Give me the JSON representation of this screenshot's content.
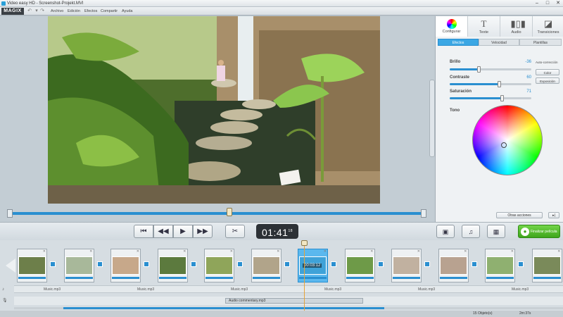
{
  "window": {
    "title": "Video easy HD - Screenshot-Projekt.MVI",
    "minimize": "–",
    "maximize": "□",
    "close": "✕"
  },
  "menu": {
    "logo": "MAGIX",
    "items": [
      "Archivo",
      "Edición",
      "Efectos",
      "Compartir",
      "Ayuda"
    ]
  },
  "panel": {
    "tabs": [
      {
        "label": "Configurar",
        "icon": "color-wheel-icon",
        "active": true
      },
      {
        "label": "Texte",
        "icon": "text-icon",
        "active": false
      },
      {
        "label": "Audio",
        "icon": "audio-icon",
        "active": false
      },
      {
        "label": "Transiciones",
        "icon": "transition-icon",
        "active": false
      }
    ],
    "subtabs": [
      {
        "label": "Efectos",
        "active": true
      },
      {
        "label": "Velocidad",
        "active": false
      },
      {
        "label": "Plantillas",
        "active": false
      }
    ],
    "sliders": [
      {
        "label": "Brillo",
        "value": "-36",
        "level": 0.35
      },
      {
        "label": "Contraste",
        "value": "60",
        "level": 0.6
      },
      {
        "label": "Saturación",
        "value": "71",
        "level": 0.64
      }
    ],
    "auto_label": "Auto-corrección",
    "buttons": [
      "Color",
      "Exposición"
    ],
    "tono_label": "Tono",
    "otras_acciones": "Otras acciones",
    "otras_arrow": "▸|"
  },
  "controls": {
    "timecode": "01:41",
    "frames": "18",
    "finish_label": "Finalizar película"
  },
  "timeline": {
    "clip_count": 12,
    "selected_clip_time": "00:03:12",
    "music_label": "Music.mp3",
    "audio_commentary": "Audio commentary.mp3",
    "status_objects": "15 Objeto(s)",
    "status_duration": "2m:37s"
  },
  "colors": {
    "accent": "#2a8fd0",
    "finish_green": "#3ea51c"
  }
}
